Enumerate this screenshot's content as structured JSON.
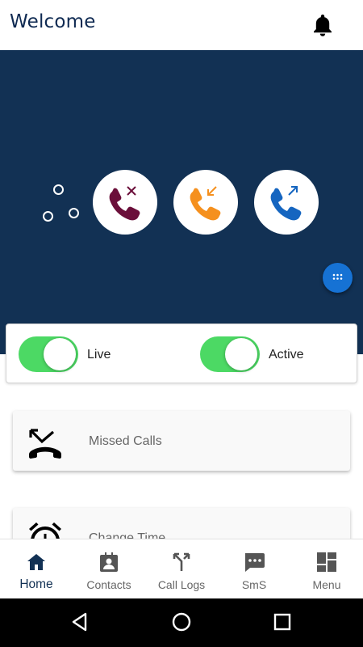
{
  "header": {
    "title": "Welcome",
    "notification_icon": "bell-icon"
  },
  "hero": {
    "call_buttons": [
      {
        "name": "missed-call-icon",
        "color": "#6b0f3a"
      },
      {
        "name": "incoming-call-icon",
        "color": "#f5901e"
      },
      {
        "name": "outgoing-call-icon",
        "color": "#1565c0"
      }
    ],
    "fab_icon": "dialpad-icon",
    "background": "#123154"
  },
  "toggles": [
    {
      "label": "Live",
      "on": true
    },
    {
      "label": "Active",
      "on": true
    }
  ],
  "menu_items": [
    {
      "label": "Missed Calls",
      "icon": "missed-call-icon"
    },
    {
      "label": "Change Time",
      "icon": "alarm-clock-icon"
    }
  ],
  "tabs": [
    {
      "label": "Home",
      "icon": "home-icon",
      "active": true
    },
    {
      "label": "Contacts",
      "icon": "contacts-icon",
      "active": false
    },
    {
      "label": "Call Logs",
      "icon": "call-split-icon",
      "active": false
    },
    {
      "label": "SmS",
      "icon": "sms-icon",
      "active": false
    },
    {
      "label": "Menu",
      "icon": "dashboard-icon",
      "active": false
    }
  ],
  "system_nav": [
    "back-icon",
    "home-circle-icon",
    "recents-icon"
  ],
  "colors": {
    "accent": "#123154",
    "toggle_on": "#4cd964",
    "fab": "#1672d4"
  }
}
